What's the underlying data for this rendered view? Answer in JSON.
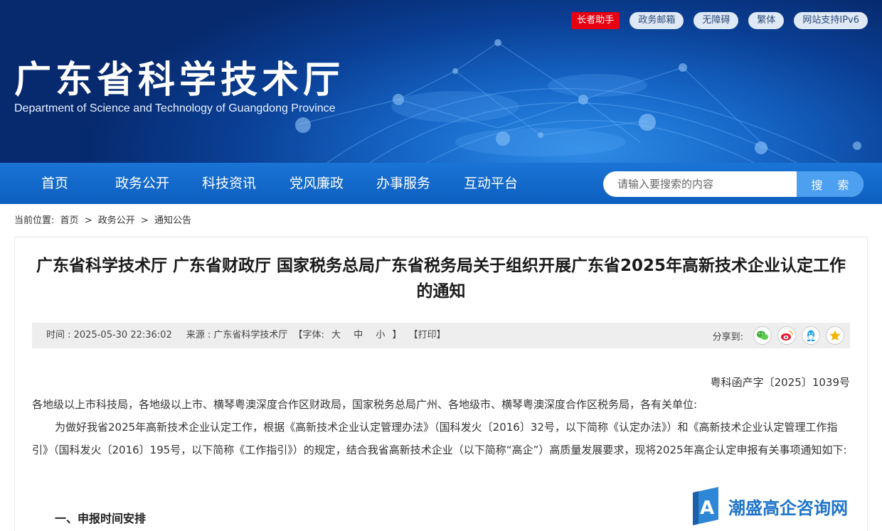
{
  "header": {
    "title": "广东省科学技术厅",
    "subtitle": "Department of Science and Technology of Guangdong Province",
    "top_links": [
      "长者助手",
      "政务邮箱",
      "无障碍",
      "繁体",
      "网站支持IPv6"
    ]
  },
  "nav": {
    "items": [
      "首页",
      "政务公开",
      "科技资讯",
      "党风廉政",
      "办事服务",
      "互动平台"
    ],
    "search_placeholder": "请输入要搜索的内容",
    "search_button": "搜 索"
  },
  "breadcrumb": {
    "prefix": "当前位置:",
    "items": [
      "首页",
      "政务公开",
      "通知公告"
    ],
    "separator": ">"
  },
  "article": {
    "title": "广东省科学技术厅 广东省财政厅 国家税务总局广东省税务局关于组织开展广东省2025年高新技术企业认定工作的通知",
    "meta": {
      "time": "时间 : 2025-05-30 22:36:02",
      "source": "来源 : 广东省科学技术厅",
      "font_label": "【字体:",
      "font_large": "大",
      "font_medium": "中",
      "font_small": "小",
      "font_close": "】",
      "print": "【打印】",
      "share_label": "分享到:"
    },
    "doc_number": "粤科函产字〔2025〕1039号",
    "recipients": "各地级以上市科技局，各地级以上市、横琴粤澳深度合作区财政局，国家税务总局广州、各地级市、横琴粤澳深度合作区税务局，各有关单位:",
    "body": "为做好我省2025年高新技术企业认定工作，根据《高新技术企业认定管理办法》（国科发火〔2016〕32号，以下简称《认定办法》）和《高新技术企业认定管理工作指引》（国科发火〔2016〕195号，以下简称《工作指引》）的规定，结合我省高新技术企业（以下简称“高企”）高质量发展要求，现将2025年高企认定申报有关事项通知如下:",
    "section1": "一、申报时间安排"
  },
  "watermark": {
    "letter": "A",
    "text": "潮盛高企咨询网"
  },
  "colors": {
    "nav_blue": "#0d5fbf",
    "elder_red": "#e60012",
    "search_button": "#4d9ff0",
    "watermark_blue": "#1d73c9"
  }
}
